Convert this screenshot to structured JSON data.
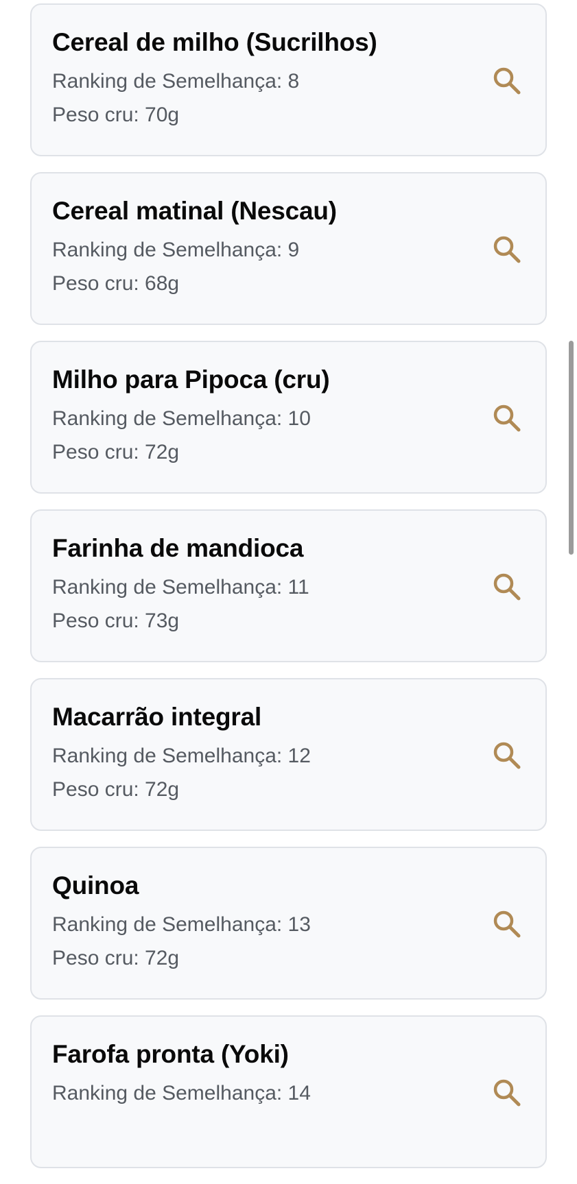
{
  "colors": {
    "accent": "#b08a55",
    "card_background": "#f8f9fb",
    "card_border": "#dfe2e7",
    "title_text": "#0a0a0a",
    "secondary_text": "#555a61",
    "scrollbar": "#9b9b9b"
  },
  "items": [
    {
      "name": "Cereal de milho (Sucrilhos)",
      "ranking": "Ranking de Semelhança: 8",
      "weight": "Peso cru: 70g",
      "icon": "search-icon"
    },
    {
      "name": "Cereal matinal (Nescau)",
      "ranking": "Ranking de Semelhança: 9",
      "weight": "Peso cru: 68g",
      "icon": "search-icon"
    },
    {
      "name": "Milho para Pipoca (cru)",
      "ranking": "Ranking de Semelhança: 10",
      "weight": "Peso cru: 72g",
      "icon": "search-icon"
    },
    {
      "name": "Farinha de mandioca",
      "ranking": "Ranking de Semelhança: 11",
      "weight": "Peso cru: 73g",
      "icon": "search-icon"
    },
    {
      "name": "Macarrão integral",
      "ranking": "Ranking de Semelhança: 12",
      "weight": "Peso cru: 72g",
      "icon": "search-icon"
    },
    {
      "name": "Quinoa",
      "ranking": "Ranking de Semelhança: 13",
      "weight": "Peso cru: 72g",
      "icon": "search-icon"
    },
    {
      "name": "Farofa pronta (Yoki)",
      "ranking": "Ranking de Semelhança: 14",
      "weight": "",
      "icon": "search-icon"
    }
  ]
}
